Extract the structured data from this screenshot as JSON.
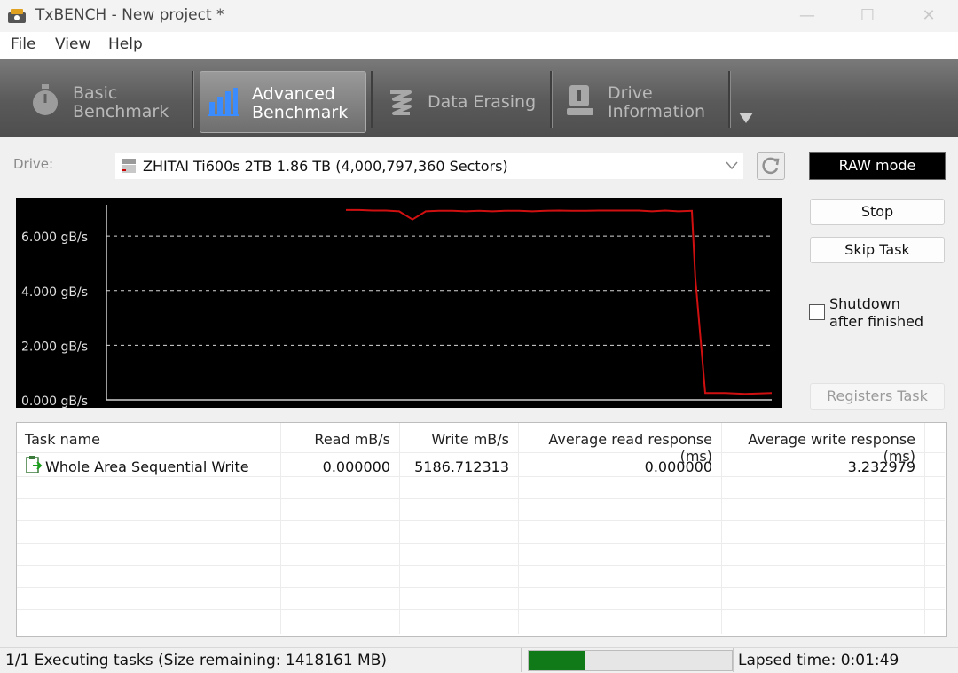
{
  "window": {
    "title": "TxBENCH - New project *",
    "minimize_glyph": "—",
    "maximize_glyph": "☐",
    "close_glyph": "✕"
  },
  "menu": [
    "File",
    "View",
    "Help"
  ],
  "tabs": [
    {
      "icon": "stopwatch-icon",
      "line1": "Basic",
      "line2": "Benchmark",
      "active": false
    },
    {
      "icon": "bar-chart-icon",
      "line1": "Advanced",
      "line2": "Benchmark",
      "active": true
    },
    {
      "icon": "erase-icon",
      "line1": "Data Erasing",
      "line2": "",
      "active": false
    },
    {
      "icon": "drive-info-icon",
      "line1": "Drive",
      "line2": "Information",
      "active": false
    }
  ],
  "drive": {
    "label": "Drive:",
    "selected": "ZHITAI Ti600s 2TB  1.86 TB (4,000,797,360 Sectors)"
  },
  "raw_mode": "RAW mode",
  "buttons": {
    "stop": "Stop",
    "skip_task": "Skip Task",
    "registers_task": "Registers Task"
  },
  "shutdown": {
    "line1": "Shutdown",
    "line2": "after finished",
    "checked": false
  },
  "chart_data": {
    "type": "line",
    "title": "",
    "ylabel": "",
    "xlabel": "",
    "ylim": [
      0,
      7.4
    ],
    "y_ticks": [
      0,
      2,
      4,
      6
    ],
    "y_tick_labels": [
      "0.000 gB/s",
      "2.000 gB/s",
      "4.000 gB/s",
      "6.000 gB/s"
    ],
    "grid": true,
    "series": [
      {
        "color": "#d01010",
        "x": [
          0.36,
          0.38,
          0.4,
          0.42,
          0.44,
          0.46,
          0.48,
          0.5,
          0.52,
          0.54,
          0.56,
          0.58,
          0.6,
          0.62,
          0.64,
          0.66,
          0.68,
          0.7,
          0.72,
          0.74,
          0.76,
          0.78,
          0.8,
          0.82,
          0.84,
          0.86,
          0.88,
          0.885,
          0.9,
          0.93,
          0.96,
          1.0
        ],
        "y": [
          6.95,
          6.95,
          6.93,
          6.93,
          6.9,
          6.6,
          6.9,
          6.92,
          6.92,
          6.9,
          6.92,
          6.9,
          6.92,
          6.92,
          6.9,
          6.92,
          6.93,
          6.92,
          6.92,
          6.93,
          6.93,
          6.93,
          6.93,
          6.9,
          6.93,
          6.9,
          6.92,
          4.5,
          0.25,
          0.25,
          0.22,
          0.25
        ]
      }
    ]
  },
  "table": {
    "columns": [
      "Task name",
      "Read mB/s",
      "Write mB/s",
      "Average read response (ms)",
      "Average write response (ms)"
    ],
    "rows": [
      {
        "task": "Whole Area Sequential Write",
        "read": "0.000000",
        "write": "5186.712313",
        "avg_read": "0.000000",
        "avg_write": "3.232979"
      }
    ]
  },
  "status": {
    "tasks": "1/1 Executing tasks (Size remaining: 1418161 MB)",
    "progress": 0.28,
    "lapsed": "Lapsed time: 0:01:49"
  }
}
